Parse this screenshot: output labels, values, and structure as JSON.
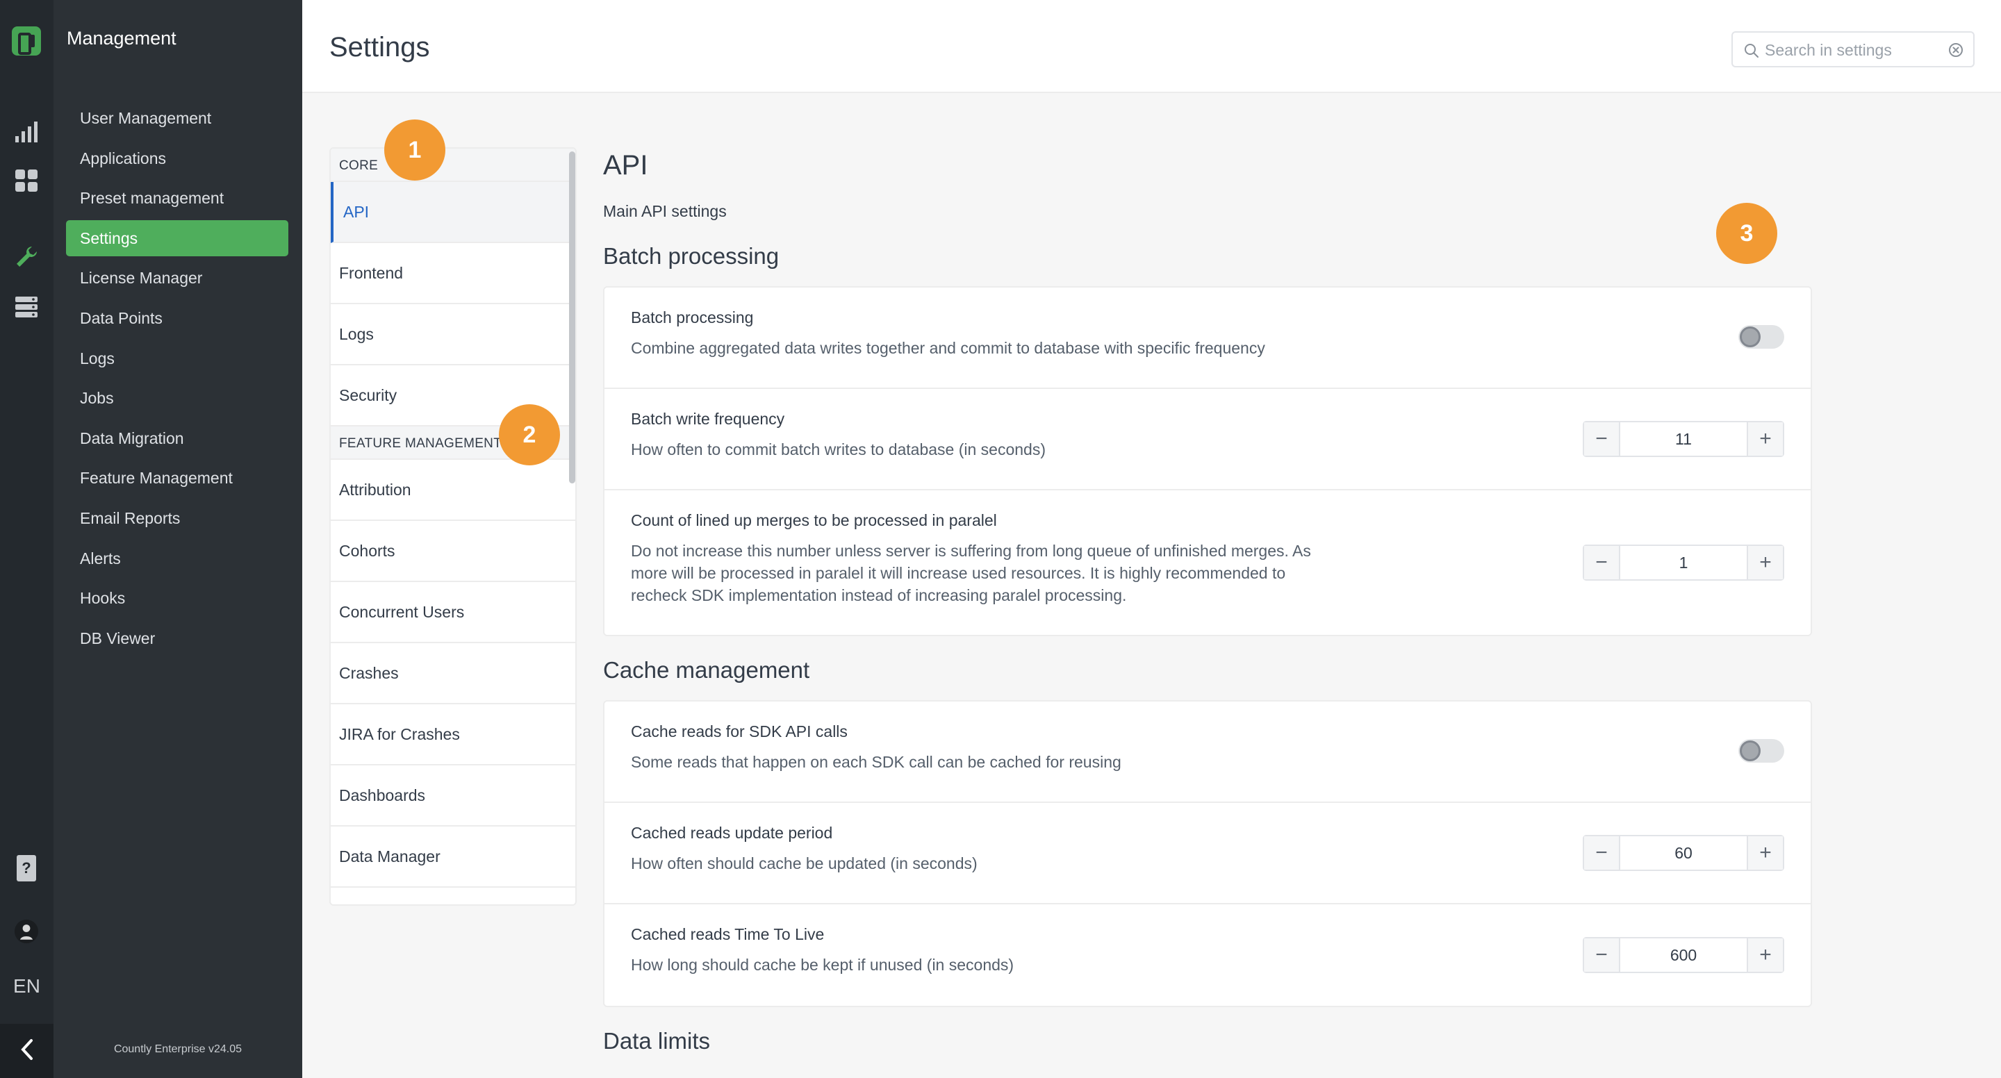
{
  "sidebar": {
    "title": "Management",
    "items": [
      {
        "label": "User Management"
      },
      {
        "label": "Applications"
      },
      {
        "label": "Preset management"
      },
      {
        "label": "Settings",
        "active": true
      },
      {
        "label": "License Manager"
      },
      {
        "label": "Data Points"
      },
      {
        "label": "Logs"
      },
      {
        "label": "Jobs"
      },
      {
        "label": "Data Migration"
      },
      {
        "label": "Feature Management"
      },
      {
        "label": "Email Reports"
      },
      {
        "label": "Alerts"
      },
      {
        "label": "Hooks"
      },
      {
        "label": "DB Viewer"
      }
    ],
    "version": "Countly Enterprise v24.05"
  },
  "rail": {
    "icons": [
      "logo-icon",
      "analytics-icon",
      "dashboards-icon",
      "management-wrench-icon",
      "database-icon",
      "help-icon",
      "user-avatar",
      "collapse-chevron-icon"
    ],
    "language": "EN"
  },
  "header": {
    "title": "Settings",
    "search_placeholder": "Search in settings"
  },
  "subnav": {
    "sections": [
      {
        "label": "CORE",
        "items": [
          {
            "label": "API",
            "active": true
          },
          {
            "label": "Frontend"
          },
          {
            "label": "Logs"
          },
          {
            "label": "Security"
          }
        ]
      },
      {
        "label": "FEATURE MANAGEMENT",
        "items": [
          {
            "label": "Attribution"
          },
          {
            "label": "Cohorts"
          },
          {
            "label": "Concurrent Users"
          },
          {
            "label": "Crashes"
          },
          {
            "label": "JIRA for Crashes"
          },
          {
            "label": "Dashboards"
          },
          {
            "label": "Data Manager"
          }
        ]
      }
    ]
  },
  "main": {
    "title": "API",
    "description": "Main API settings",
    "batch": {
      "heading": "Batch processing",
      "rows": [
        {
          "label": "Batch processing",
          "desc": "Combine aggregated data writes together and commit to database with specific frequency",
          "toggle": false
        },
        {
          "label": "Batch write frequency",
          "desc": "How often to commit batch writes to database (in seconds)",
          "value": "11"
        },
        {
          "label": "Count of lined up merges to be processed in paralel",
          "desc": "Do not increase this number unless server is suffering from long queue of unfinished merges. As more will be processed in paralel it will increase used resources. It is highly recommended to recheck SDK implementation instead of increasing paralel processing.",
          "value": "1"
        }
      ]
    },
    "cache": {
      "heading": "Cache management",
      "rows": [
        {
          "label": "Cache reads for SDK API calls",
          "desc": "Some reads that happen on each SDK call can be cached for reusing",
          "toggle": false
        },
        {
          "label": "Cached reads update period",
          "desc": "How often should cache be updated (in seconds)",
          "value": "60"
        },
        {
          "label": "Cached reads Time To Live",
          "desc": "How long should cache be kept if unused (in seconds)",
          "value": "600"
        }
      ]
    },
    "limits": {
      "heading": "Data limits"
    }
  },
  "markers": [
    "1",
    "2",
    "3"
  ],
  "colors": {
    "accent_green": "#4fae5c",
    "active_link": "#2466c5",
    "marker": "#f29a33",
    "rail_bg": "#24292e",
    "sidebar_bg": "#2c3136"
  }
}
